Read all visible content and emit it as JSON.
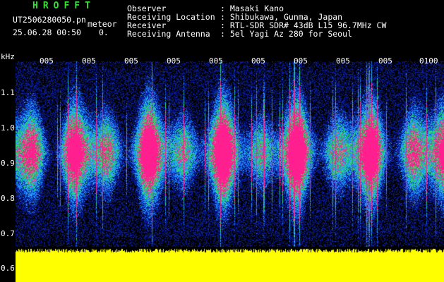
{
  "header": {
    "app_title": "HROFFT",
    "filename": "UT2506280050.pn",
    "mode": "meteor",
    "datetime": "25.06.28 00:50",
    "count": "0.",
    "fields": [
      {
        "label": "Observer",
        "value": ": Masaki Kano"
      },
      {
        "label": "Receiving Location",
        "value": ": Shibukawa, Gunma, Japan"
      },
      {
        "label": "Receiver",
        "value": ": RTL-SDR SDR# 43dB L15 96.7MHz CW"
      },
      {
        "label": "Receiving Antenna",
        "value": ": 5el Yagi Az 280 for Seoul"
      }
    ]
  },
  "axis": {
    "unit": "kHz",
    "y_ticks": [
      "1.1",
      "1.0",
      "0.9",
      "0.8",
      "0.7",
      "0.6"
    ],
    "x_ticks": [
      "005",
      "005",
      "005",
      "005",
      "005",
      "005",
      "005",
      "005",
      "005",
      "0100"
    ]
  },
  "colors": {
    "background": "#000000",
    "noise_low": "#0b1e9a",
    "noise_mid": "#1e8fff",
    "signal_green": "#2edc6e",
    "signal_hot": "#ff1f8e",
    "baseline": "#ffff00"
  }
}
